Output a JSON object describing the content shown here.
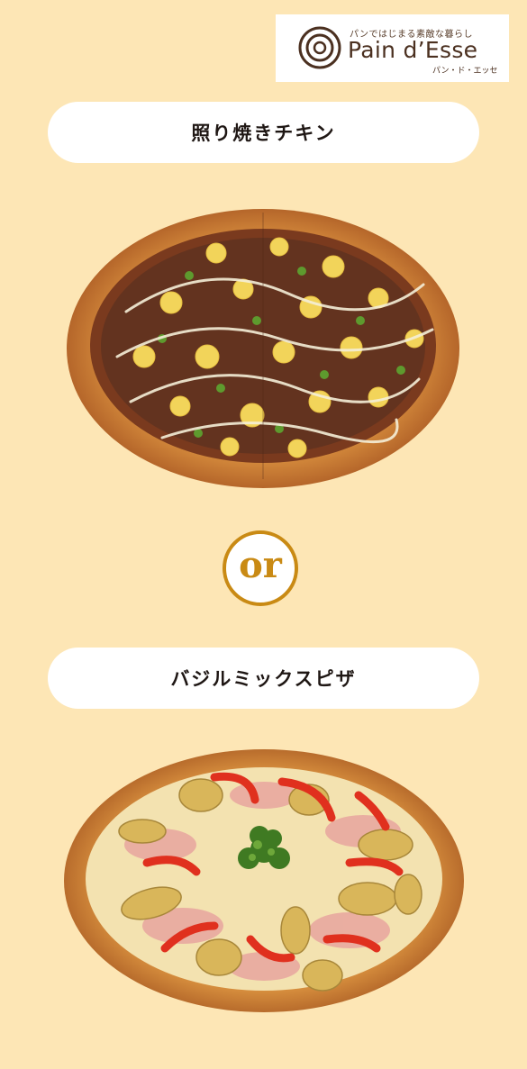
{
  "brand": {
    "tagline": "パンではじまる素敵な暮らし",
    "name": "Pain d’Esse",
    "kana": "パン・ド・エッセ"
  },
  "items": [
    {
      "label": "照り焼きチキン"
    },
    {
      "label": "バジルミックスピザ"
    }
  ],
  "separator": "or",
  "colors": {
    "background": "#fde6b5",
    "accent": "#c98a14",
    "logo_brown": "#4b3020"
  }
}
